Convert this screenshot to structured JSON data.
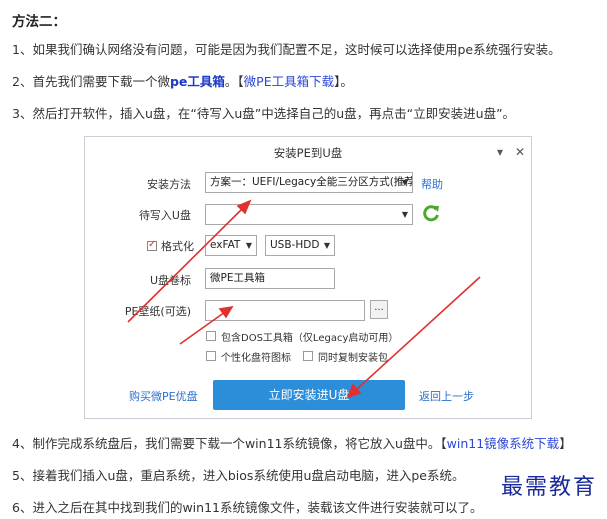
{
  "heading": "方法二：",
  "steps": {
    "s1": "1、如果我们确认网络没有问题，可能是因为我们配置不足，这时候可以选择使用pe系统强行安装。",
    "s2_pre": "2、首先我们需要下载一个微",
    "s2_bold": "pe工具箱",
    "s2_mid": "。【",
    "s2_link": "微PE工具箱下载",
    "s2_post": "】。",
    "s3": "3、然后打开软件，插入u盘，在“待写入u盘”中选择自己的u盘，再点击“立即安装进u盘”。",
    "s4_pre": "4、制作完成系统盘后，我们需要下载一个win11系统镜像，将它放入u盘中。【",
    "s4_link": "win11镜像系统下载",
    "s4_post": "】",
    "s5": "5、接着我们插入u盘，重启系统，进入bios系统使用u盘启动电脑，进入pe系统。",
    "s6": "6、进入之后在其中找到我们的win11系统镜像文件，装载该文件进行安装就可以了。"
  },
  "dialog": {
    "title": "安装PE到U盘",
    "minimize": "▾",
    "close": "✕",
    "method_label": "安装方法",
    "method_value": "方案一：UEFI/Legacy全能三分区方式(推荐)",
    "help": "帮助",
    "target_label": "待写入U盘",
    "target_value": "",
    "format_label": "格式化",
    "fs_value": "exFAT",
    "mode_value": "USB-HDD",
    "volume_label": "U盘卷标",
    "volume_value": "微PE工具箱",
    "wallpaper_label": "PE壁纸(可选)",
    "wallpaper_value": "",
    "browse": "...",
    "opt_dos": "包含DOS工具箱（仅Legacy启动可用）",
    "opt_icon": "个性化盘符图标",
    "opt_copy": "同时复制安装包",
    "buy": "购买微PE优盘",
    "install": "立即安装进U盘",
    "back": "返回上一步"
  },
  "watermark": "最需教育",
  "colors": {
    "accent": "#2c8dd8",
    "link": "#2c47d6",
    "arrow": "#e03030",
    "watermark": "#1a2a9a"
  }
}
